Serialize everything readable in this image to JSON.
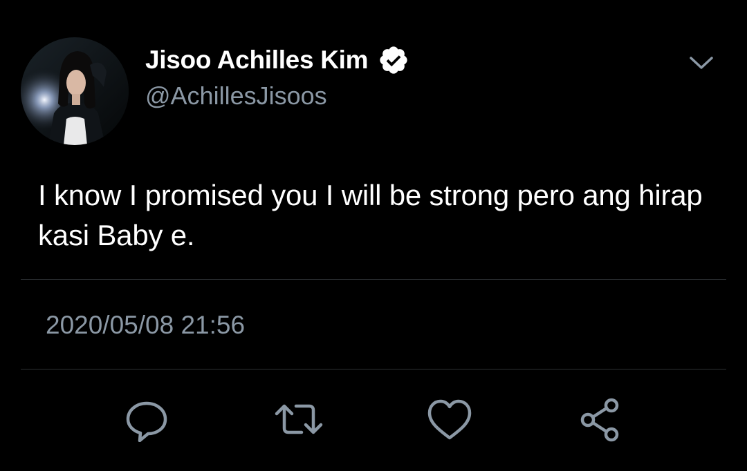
{
  "tweet": {
    "author": {
      "display_name": "Jisoo Achilles Kim",
      "handle": "@AchillesJisoos",
      "verified": true,
      "avatar_icon": "profile-photo"
    },
    "text": "I know I promised you I will be strong pero ang hirap kasi Baby e.",
    "timestamp": "2020/05/08 21:56"
  },
  "actions": [
    {
      "name": "reply",
      "icon": "speech-bubble-icon"
    },
    {
      "name": "retweet",
      "icon": "retweet-arrows-icon"
    },
    {
      "name": "like",
      "icon": "heart-icon"
    },
    {
      "name": "share",
      "icon": "share-nodes-icon"
    }
  ],
  "colors": {
    "background": "#000000",
    "primary_text": "#ffffff",
    "secondary_text": "#8b98a5",
    "divider": "#2f3336",
    "icon": "#8b98a5"
  }
}
